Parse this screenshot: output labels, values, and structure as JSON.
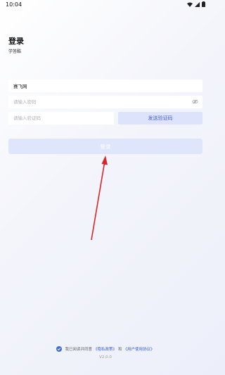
{
  "status_bar": {
    "time": "10:04"
  },
  "header": {
    "title": "登录",
    "subtitle": "学答酷"
  },
  "form": {
    "username_value": "赛飞网",
    "password_placeholder": "请输入密码",
    "code_placeholder": "请输入验证码",
    "send_code_label": "发送验证码",
    "login_label": "登录"
  },
  "agreement": {
    "prefix": "我已阅读并同意",
    "privacy_link": "《隐私政策》",
    "and": "和",
    "user_link": "《用户使用协议》"
  },
  "version": "V2.0.0",
  "icons": {
    "eye": "eye-slash-icon",
    "check": "check-icon",
    "wifi": "wifi-icon",
    "signal": "signal-icon",
    "battery": "battery-icon"
  },
  "colors": {
    "accent": "#3f6ad8",
    "button_bg": "#dfe5fb",
    "annotation_arrow": "#d6252b"
  }
}
